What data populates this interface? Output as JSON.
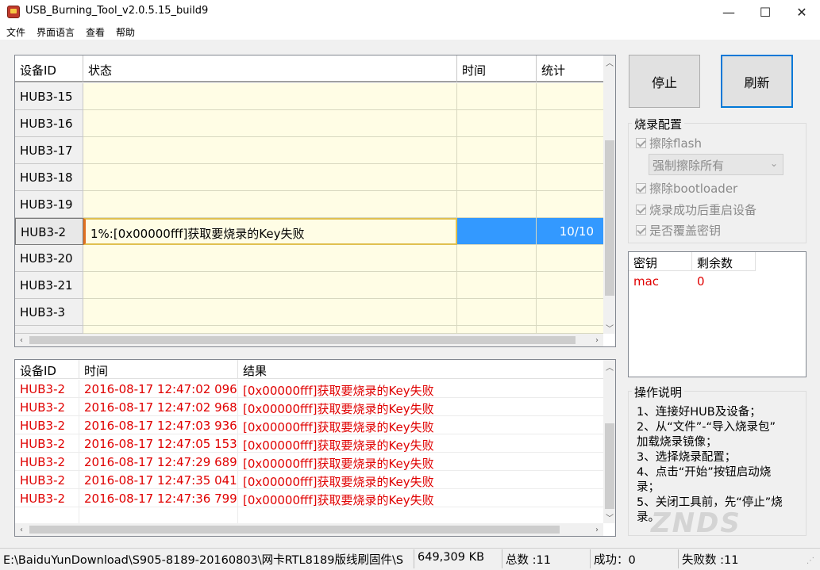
{
  "window": {
    "title": "USB_Burning_Tool_v2.0.5.15_build9",
    "minimize": "—",
    "maximize": "☐",
    "close": "✕"
  },
  "menu": [
    "文件",
    "界面语言",
    "查看",
    "帮助"
  ],
  "device_grid": {
    "headers": [
      "设备ID",
      "状态",
      "时间",
      "统计"
    ],
    "rows": [
      {
        "id": "HUB3-15",
        "status": "",
        "time": "",
        "count": ""
      },
      {
        "id": "HUB3-16",
        "status": "",
        "time": "",
        "count": ""
      },
      {
        "id": "HUB3-17",
        "status": "",
        "time": "",
        "count": ""
      },
      {
        "id": "HUB3-18",
        "status": "",
        "time": "",
        "count": ""
      },
      {
        "id": "HUB3-19",
        "status": "",
        "time": "",
        "count": ""
      },
      {
        "id": "HUB3-2",
        "status": "1%:[0x00000fff]获取要烧录的Key失败",
        "time": "",
        "count": "10/10"
      },
      {
        "id": "HUB3-20",
        "status": "",
        "time": "",
        "count": ""
      },
      {
        "id": "HUB3-21",
        "status": "",
        "time": "",
        "count": ""
      },
      {
        "id": "HUB3-3",
        "status": "",
        "time": "",
        "count": ""
      }
    ],
    "selected_index": 5
  },
  "log_grid": {
    "headers": [
      "设备ID",
      "时间",
      "结果"
    ],
    "rows": [
      {
        "id": "HUB3-2",
        "time": "2016-08-17 12:47:02 096",
        "result": "[0x00000fff]获取要烧录的Key失败"
      },
      {
        "id": "HUB3-2",
        "time": "2016-08-17 12:47:02 968",
        "result": "[0x00000fff]获取要烧录的Key失败"
      },
      {
        "id": "HUB3-2",
        "time": "2016-08-17 12:47:03 936",
        "result": "[0x00000fff]获取要烧录的Key失败"
      },
      {
        "id": "HUB3-2",
        "time": "2016-08-17 12:47:05 153",
        "result": "[0x00000fff]获取要烧录的Key失败"
      },
      {
        "id": "HUB3-2",
        "time": "2016-08-17 12:47:29 689",
        "result": "[0x00000fff]获取要烧录的Key失败"
      },
      {
        "id": "HUB3-2",
        "time": "2016-08-17 12:47:35 041",
        "result": "[0x00000fff]获取要烧录的Key失败"
      },
      {
        "id": "HUB3-2",
        "time": "2016-08-17 12:47:36 799",
        "result": "[0x00000fff]获取要烧录的Key失败"
      }
    ]
  },
  "buttons": {
    "stop": "停止",
    "refresh": "刷新"
  },
  "burn_config": {
    "title": "烧录配置",
    "erase_flash": "擦除flash",
    "erase_mode": "强制擦除所有",
    "erase_bootloader": "擦除bootloader",
    "reboot_after_success": "烧录成功后重启设备",
    "overwrite_key": "是否覆盖密钥"
  },
  "keys": {
    "headers": [
      "密钥",
      "剩余数"
    ],
    "rows": [
      {
        "name": "mac",
        "remaining": "0"
      }
    ]
  },
  "instructions": {
    "title": "操作说明",
    "lines": [
      "1、连接好HUB及设备；",
      "2、从“文件”-“导入烧录包”",
      "加载烧录镜像；",
      "3、选择烧录配置；",
      "4、点击“开始”按钮启动烧",
      "录；",
      "5、关闭工具前，先“停止”烧",
      "录。"
    ]
  },
  "status_bar": {
    "path": "E:\\BaiduYunDownload\\S905-8189-20160803\\网卡RTL8189版线刷固件\\S",
    "size": "649,309 KB",
    "total": "总数 :11",
    "success": "成功：0",
    "failed": "失败数 :11"
  },
  "watermark": "ZNDS",
  "colors": {
    "error_red": "#e00000",
    "selection_blue": "#3399ff",
    "row_yellow": "#fffde5",
    "accent_border": "#0078d7"
  }
}
